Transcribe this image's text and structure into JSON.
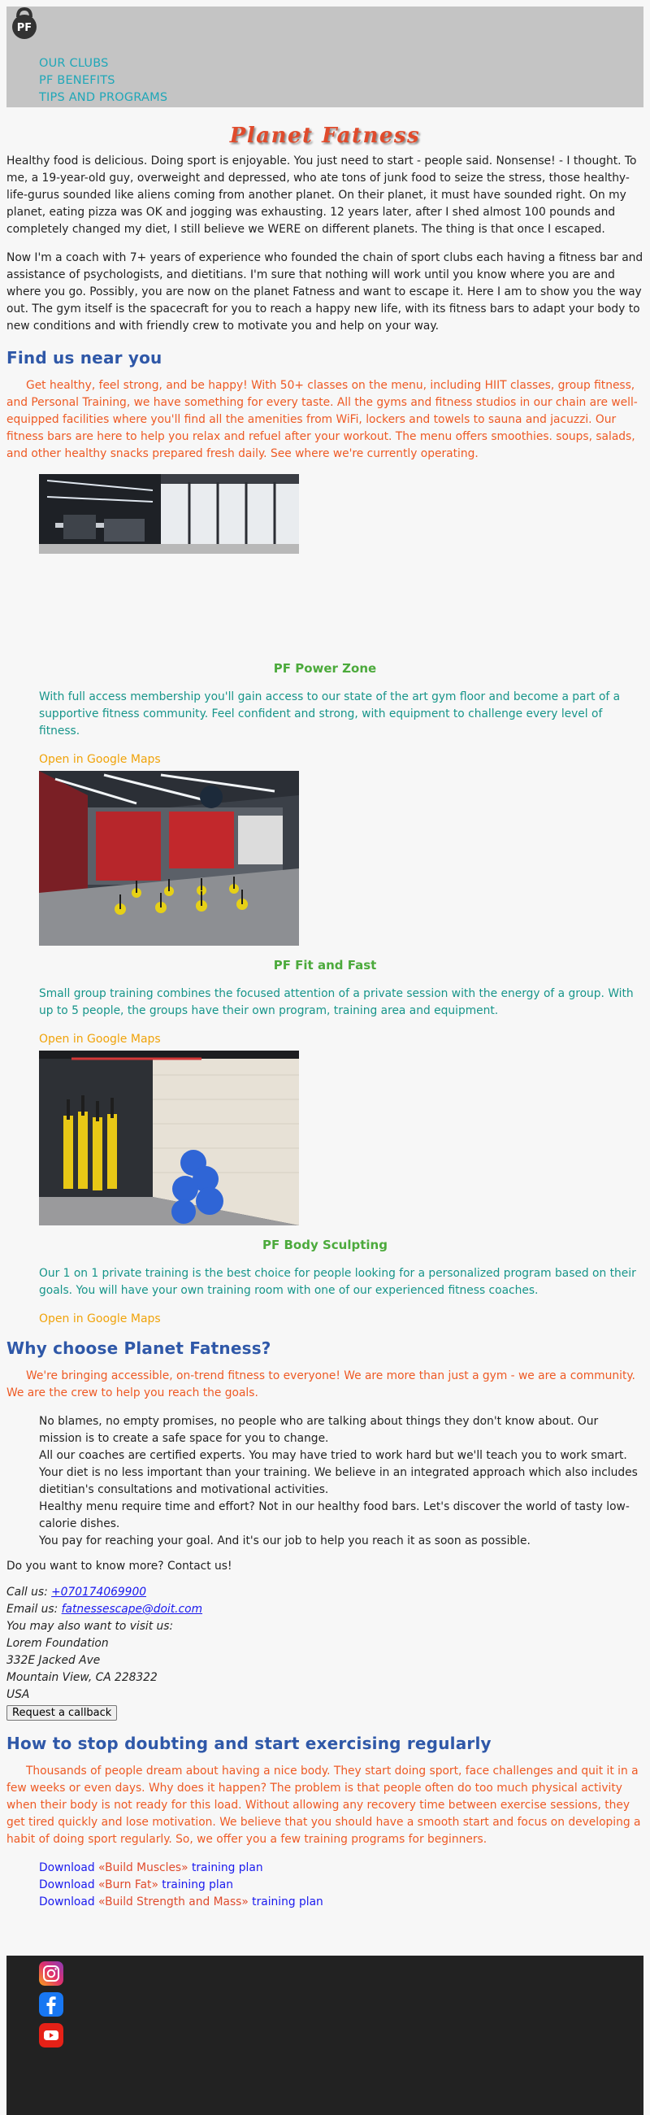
{
  "header": {
    "logo_text": "PF",
    "nav": [
      "OUR CLUBS",
      "PF BENEFITS",
      "TIPS AND PROGRAMS"
    ]
  },
  "brand": "Planet Fatness",
  "intro": [
    "Healthy food is delicious. Doing sport is enjoyable. You just need to start - people said. Nonsense! - I thought. To me, a 19-year-old guy, overweight and depressed, who ate tons of junk food to seize the stress, those healthy-life-gurus sounded like aliens coming from another planet. On their planet, it must have sounded right. On my planet, eating pizza was OK and jogging was exhausting. 12 years later, after I shed almost 100 pounds and completely changed my diet, I still believe we WERE on different planets. The thing is that once I escaped.",
    "Now I'm a coach with 7+ years of experience who founded the chain of sport clubs each having a fitness bar and assistance of psychologists, and dietitians. I'm sure that nothing will work until you know where you are and where you go. Possibly, you are now on the planet Fatness and want to escape it. Here I am to show you the way out. The gym itself is the spacecraft for you to reach a happy new life, with its fitness bars to adapt your body to new conditions and with friendly crew to motivate you and help on your way."
  ],
  "find_us": {
    "heading": "Find us near you",
    "text": "Get healthy, feel strong, and be happy! With 50+ classes on the menu, including HIIT classes, group fitness, and Personal Training, we have something for every taste. All the gyms and fitness studios in our chain are well-equipped facilities where you'll find all the amenities from WiFi, lockers and towels to sauna and jacuzzi. Our fitness bars are here to help you relax and refuel after your workout. The menu offers smoothies. soups, salads, and other healthy snacks prepared fresh daily. See where we're currently operating."
  },
  "clubs": [
    {
      "name": "PF Power Zone",
      "description": "With full access membership you'll gain access to our state of the art gym floor and become a part of a supportive fitness community. Feel confident and strong, with equipment to challenge every level of fitness.",
      "maps_link": "Open in Google Maps"
    },
    {
      "name": "PF Fit and Fast",
      "description": "Small group training combines the focused attention of a private session with the energy of a group. With up to 5 people, the groups have their own program, training area and equipment.",
      "maps_link": "Open in Google Maps"
    },
    {
      "name": "PF Body Sculpting",
      "description": "Our 1 on 1 private training is the best choice for people looking for a personalized program based on their goals. You will have your own training room with one of our experienced fitness coaches.",
      "maps_link": "Open in Google Maps"
    }
  ],
  "why": {
    "heading": "Why choose Planet Fatness?",
    "text": "We're bringing accessible, on-trend fitness to everyone! We are more than just a gym - we are a community. We are the crew to help you reach the goals.",
    "points": [
      "No blames, no empty promises, no people who are talking about things they don't know about. Our mission is to create a safe space for you to change.",
      "All our coaches are certified experts. You may have tried to work hard but we'll teach you to work smart.",
      "Your diet is no less important than your training. We believe in an integrated approach which also includes dietitian's consultations and motivational activities.",
      "Healthy menu require time and effort? Not in our healthy food bars. Let's discover the world of tasty low-calorie dishes.",
      "You pay for reaching your goal. And it's our job to help you reach it as soon as possible."
    ]
  },
  "contact": {
    "question": "Do you want to know more? Contact us!",
    "call_label": "Call us: ",
    "phone": "+070174069900",
    "email_label": "Email us: ",
    "email": "fatnessescape@doit.com",
    "visit": "You may also want to visit us:",
    "address_lines": [
      "Lorem Foundation",
      "332E Jacked Ave",
      "Mountain View, CA 228322",
      "USA"
    ],
    "callback_button": "Request a callback"
  },
  "doubt": {
    "heading": "How to stop doubting and start exercising regularly",
    "text": "Thousands of people dream about having a nice body. They start doing sport, face challenges and quit it in a few weeks or even days. Why does it happen? The problem is that people often do too much physical activity when their body is not ready for this load. Without allowing any recovery time between exercise sessions, they get tired quickly and lose motivation. We believe that you should have a smooth start and focus on developing a habit of doing sport regularly. So, we offer you a few training programs for beginners.",
    "downloads": [
      {
        "prefix": "Download ",
        "name": "«Build Muscles»",
        "suffix": " training plan"
      },
      {
        "prefix": "Download ",
        "name": "«Burn Fat»",
        "suffix": " training plan"
      },
      {
        "prefix": "Download ",
        "name": "«Build Strength and Mass»",
        "suffix": " training plan"
      }
    ]
  },
  "footer": {
    "social_icons": [
      "instagram-icon",
      "facebook-icon",
      "youtube-icon"
    ]
  },
  "colors": {
    "nav": "#1fa7b8",
    "brand": "#e04b2c",
    "heading": "#2f58a8",
    "orange_text": "#ee5a24",
    "club_title": "#4caa3c",
    "club_text": "#17958a",
    "maps_link": "#f0a30a",
    "footer_bg": "#222222"
  }
}
